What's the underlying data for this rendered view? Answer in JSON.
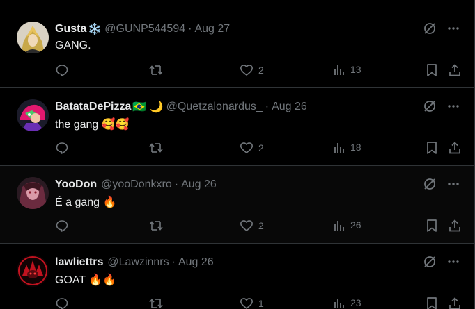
{
  "colors": {
    "background": "#000000",
    "text_primary": "#e7e9ea",
    "text_secondary": "#71767b",
    "divider": "#2f3336"
  },
  "tweets": [
    {
      "display_name": "Gusta",
      "name_emoji": "❄️",
      "handle": "@GUNP544594",
      "separator": "·",
      "date": "Aug 27",
      "text": "GANG.",
      "reply_count": "",
      "retweet_count": "",
      "like_count": "2",
      "view_count": "13"
    },
    {
      "display_name": "BatataDePizza",
      "name_emoji": "🇧🇷 🌙",
      "handle": "@Quetzalonardus_",
      "separator": "·",
      "date": "Aug 26",
      "text": "the gang 🥰🥰",
      "reply_count": "",
      "retweet_count": "",
      "like_count": "2",
      "view_count": "18"
    },
    {
      "display_name": "YooDon",
      "name_emoji": "",
      "handle": "@yooDonkxro",
      "separator": "·",
      "date": "Aug 26",
      "text": "É a gang 🔥",
      "reply_count": "",
      "retweet_count": "",
      "like_count": "2",
      "view_count": "26"
    },
    {
      "display_name": "lawliettrs",
      "name_emoji": "",
      "handle": "@Lawzinnrs",
      "separator": "·",
      "date": "Aug 26",
      "text": "GOAT 🔥🔥",
      "reply_count": "",
      "retweet_count": "",
      "like_count": "1",
      "view_count": "23"
    }
  ]
}
